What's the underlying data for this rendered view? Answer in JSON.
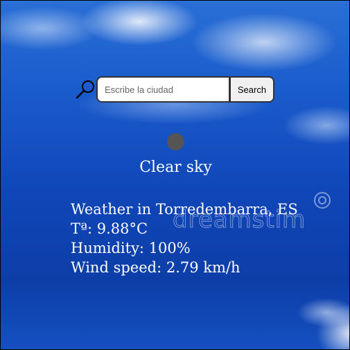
{
  "search": {
    "placeholder": "Escribe la ciudad",
    "value": "",
    "button_label": "Search"
  },
  "weather": {
    "description": "Clear sky",
    "location_line": "Weather in Torredembarra, ES",
    "temperature_line": "Tª: 9.88°C",
    "humidity_line": "Humidity: 100%",
    "wind_line": "Wind speed: 2.79 km/h"
  },
  "background": {
    "watermark_text": "dreamstim"
  },
  "colors": {
    "sky": "#1a5ccc",
    "text": "#ffffff",
    "icon": "#555555"
  },
  "icons": {
    "search": "magnifier-icon",
    "weather": "weather-status-icon"
  }
}
